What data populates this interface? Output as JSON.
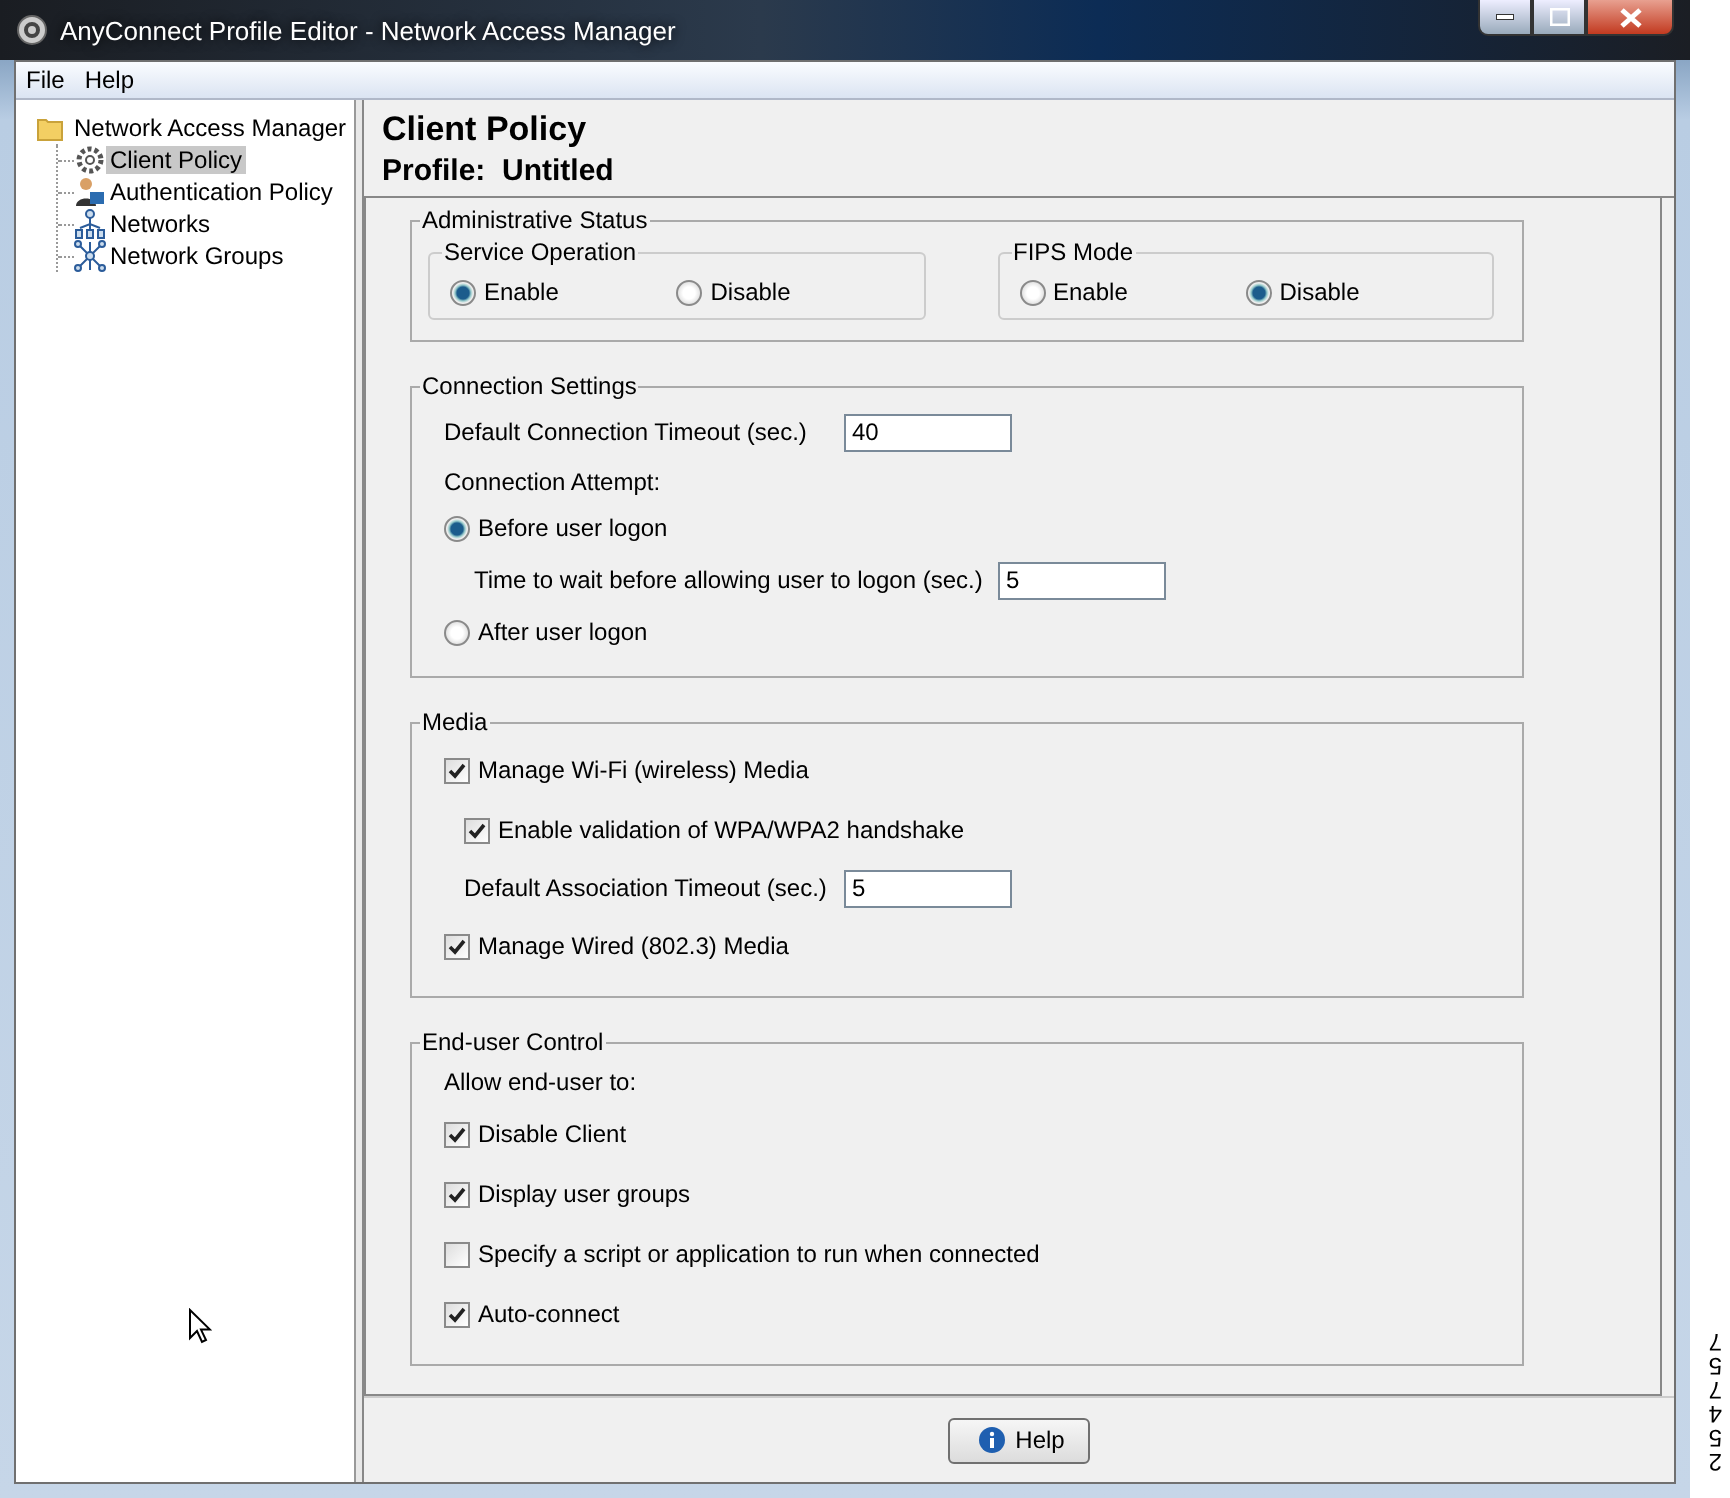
{
  "window": {
    "title": "AnyConnect Profile Editor - Network Access Manager"
  },
  "menu": [
    "File",
    "Help"
  ],
  "tree": {
    "label": "Network Access Manager",
    "children": [
      {
        "label": "Client Policy",
        "selected": true
      },
      {
        "label": "Authentication Policy",
        "selected": false
      },
      {
        "label": "Networks",
        "selected": false
      },
      {
        "label": "Network Groups",
        "selected": false
      }
    ]
  },
  "header": {
    "title": "Client Policy",
    "profile": "Profile:  Untitled"
  },
  "sections": [
    {
      "title": "Administrative Status",
      "items": [
        {
          "kind": "radio_groups",
          "groups": [
            {
              "title": "Service Operation",
              "options": [
                {
                  "label": "Enable",
                  "selected": true
                },
                {
                  "label": "Disable",
                  "selected": false
                }
              ]
            },
            {
              "title": "FIPS Mode",
              "options": [
                {
                  "label": "Enable",
                  "selected": false
                },
                {
                  "label": "Disable",
                  "selected": true
                }
              ]
            }
          ]
        }
      ]
    },
    {
      "title": "Connection Settings",
      "items": [
        {
          "kind": "field",
          "label": "Default Connection Timeout (sec.)",
          "value": "40"
        },
        {
          "kind": "label",
          "label": "Connection Attempt:"
        },
        {
          "kind": "radio",
          "label": "Before user logon",
          "selected": true,
          "children": [
            {
              "kind": "field",
              "label": "Time to wait before allowing user to logon (sec.)",
              "value": "5"
            }
          ]
        },
        {
          "kind": "radio",
          "label": "After user logon",
          "selected": false
        }
      ]
    },
    {
      "title": "Media",
      "items": [
        {
          "kind": "checkbox",
          "label": "Manage Wi-Fi (wireless) Media",
          "checked": true,
          "children": [
            {
              "kind": "checkbox",
              "label": "Enable validation of WPA/WPA2 handshake",
              "checked": true
            },
            {
              "kind": "field",
              "label": "Default Association Timeout (sec.)",
              "value": "5"
            }
          ]
        },
        {
          "kind": "checkbox",
          "label": "Manage Wired (802.3) Media",
          "checked": true
        }
      ]
    },
    {
      "title": "End-user Control",
      "items": [
        {
          "kind": "label",
          "label": "Allow end-user to:"
        },
        {
          "kind": "checkbox",
          "label": "Disable Client",
          "checked": true
        },
        {
          "kind": "checkbox",
          "label": "Display user groups",
          "checked": true
        },
        {
          "kind": "checkbox",
          "label": "Specify a script or application to run when connected",
          "checked": false
        },
        {
          "kind": "checkbox",
          "label": "Auto-connect",
          "checked": true
        }
      ]
    }
  ],
  "help_button": "Help",
  "figure_number": "254757"
}
